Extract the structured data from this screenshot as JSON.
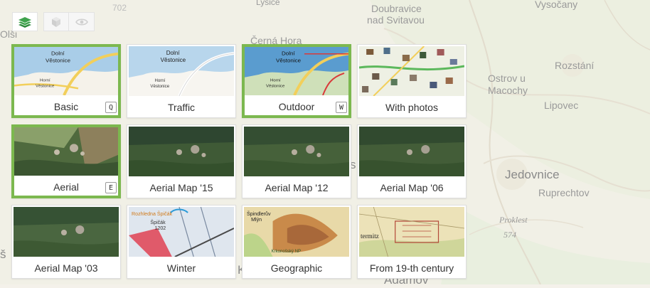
{
  "map": {
    "place_names": [
      "702",
      "Lysice",
      "Doubravice",
      "nad Svitavou",
      "Vysočany",
      "Olši",
      "Černá Hora",
      "Ostrov u",
      "Macochy",
      "Rozstání",
      "Lipovec",
      "Jedovnice",
      "Ruprechtov",
      "Proklest",
      "574",
      "Adamov",
      "š",
      "s",
      "K"
    ]
  },
  "toolbar": {
    "layers_icon": "layers-icon",
    "cube_icon": "cube-3d-icon",
    "eye_icon": "eye-icon"
  },
  "layers": [
    {
      "label": "Basic",
      "key": "Q",
      "active": true,
      "thumb": "basic"
    },
    {
      "label": "Traffic",
      "key": "",
      "active": false,
      "thumb": "traffic"
    },
    {
      "label": "Outdoor",
      "key": "W",
      "active": true,
      "thumb": "outdoor"
    },
    {
      "label": "With photos",
      "key": "",
      "active": false,
      "thumb": "photos"
    },
    {
      "label": "Aerial",
      "key": "E",
      "active": true,
      "thumb": "aerial"
    },
    {
      "label": "Aerial Map '15",
      "key": "",
      "active": false,
      "thumb": "aerial"
    },
    {
      "label": "Aerial Map '12",
      "key": "",
      "active": false,
      "thumb": "aerial"
    },
    {
      "label": "Aerial Map '06",
      "key": "",
      "active": false,
      "thumb": "aerial"
    },
    {
      "label": "Aerial Map '03",
      "key": "",
      "active": false,
      "thumb": "aerial"
    },
    {
      "label": "Winter",
      "key": "",
      "active": false,
      "thumb": "winter"
    },
    {
      "label": "Geographic",
      "key": "",
      "active": false,
      "thumb": "geographic"
    },
    {
      "label": "From 19-th century",
      "key": "",
      "active": false,
      "thumb": "historic"
    }
  ],
  "thumb_text": {
    "basic": [
      "Dolní",
      "Věstonice",
      "Horní",
      "Věstonice"
    ],
    "traffic": [
      "Dolní",
      "Věstonice",
      "Horní",
      "Věstonice"
    ],
    "outdoor": [
      "Dolní",
      "Věstonice",
      "Horní",
      "Věstonice"
    ],
    "winter": [
      "Rozhledna Špičák",
      "Špičák",
      "1202"
    ],
    "geographic": [
      "Špindlerův",
      "Mlýn",
      "Krkonošský NP"
    ],
    "historic": [
      "termitz"
    ]
  },
  "colors": {
    "active_border": "#7cb84f",
    "water": "#a9cde8",
    "road": "#f2cf5b"
  }
}
